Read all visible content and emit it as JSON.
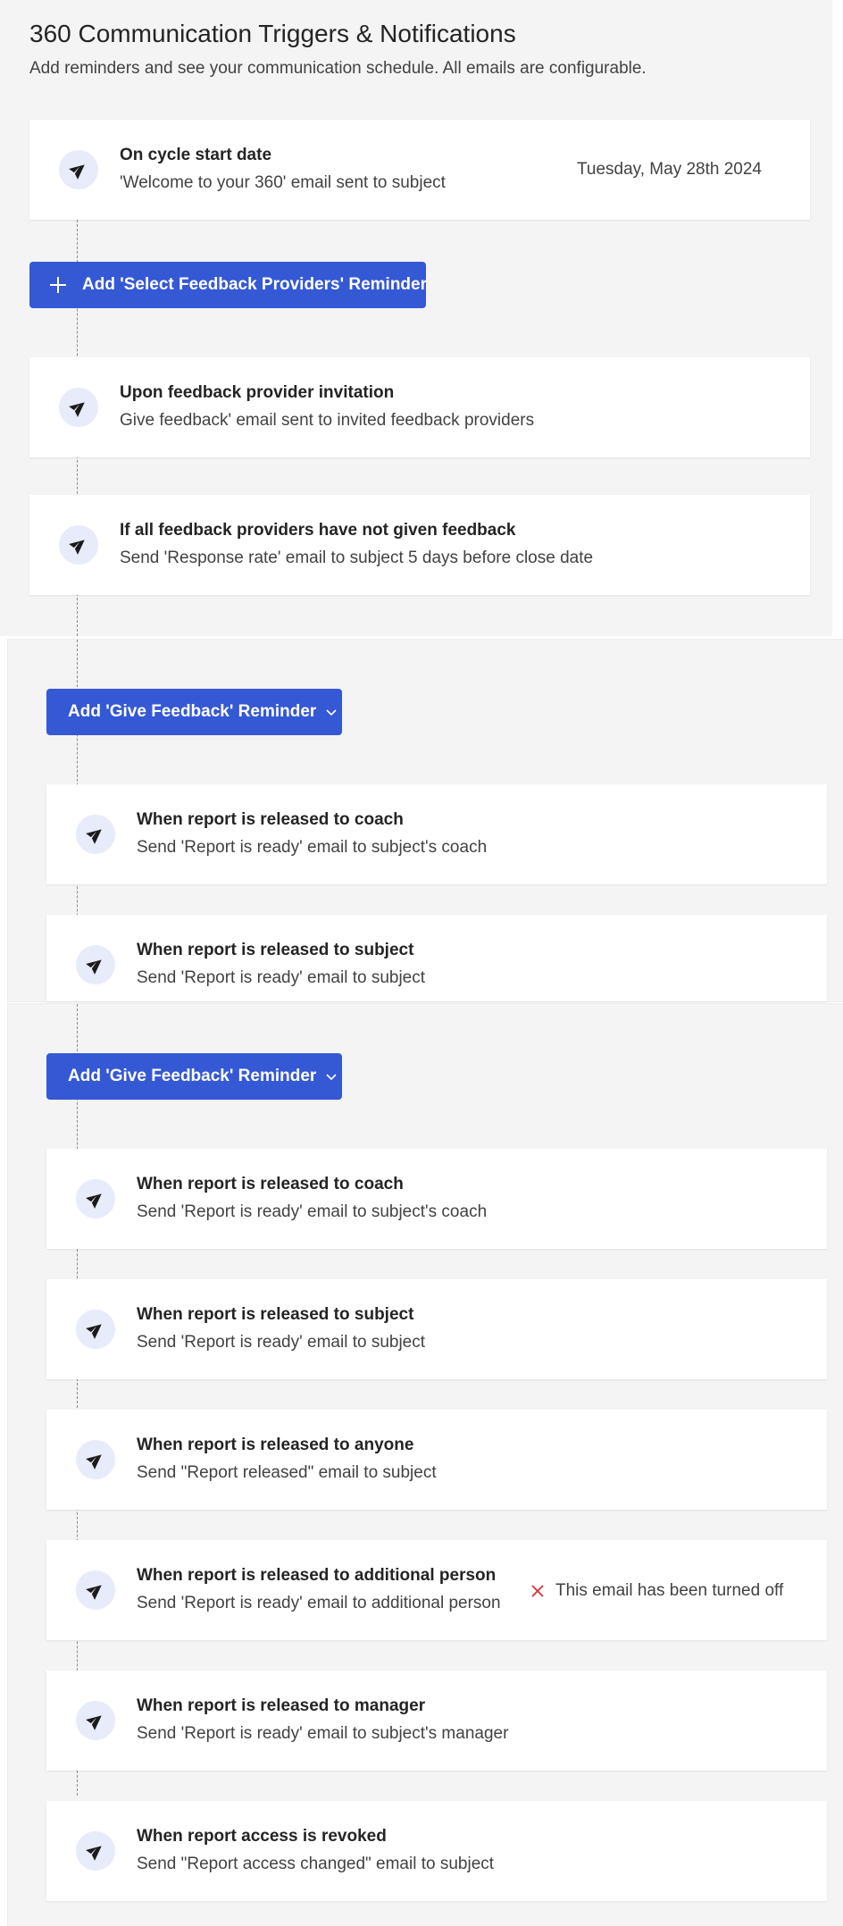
{
  "header": {
    "title": "360 Communication Triggers & Notifications",
    "subtitle": "Add reminders and see your communication schedule. All emails are configurable."
  },
  "colors": {
    "accent": "#3558d4",
    "icon_bg": "#e8ebfa",
    "off_icon": "#d13438",
    "panel_bg": "#f4f4f4"
  },
  "icons": {
    "trigger": "send-icon",
    "add": "plus-icon",
    "dropdown": "chevron-down-icon",
    "off": "close-icon"
  },
  "cards": [
    {
      "title": "On cycle start date",
      "desc": "'Welcome to your 360' email sent to subject",
      "date": "Tuesday, May 28th 2024"
    },
    {
      "title": "Upon feedback provider invitation",
      "desc": "Give feedback' email sent to invited feedback providers"
    },
    {
      "title": "If all feedback providers have not given feedback",
      "desc": "Send 'Response rate' email to subject 5 days before close date"
    },
    {
      "title": "When report is released to coach",
      "desc": "Send 'Report is ready' email to subject's coach"
    },
    {
      "title": "When report is released to subject",
      "desc": "Send 'Report is ready' email to subject"
    },
    {
      "title": "When report is released to coach",
      "desc": "Send 'Report is ready' email to subject's coach"
    },
    {
      "title": "When report is released to subject",
      "desc": "Send 'Report is ready' email to subject"
    },
    {
      "title": "When report is released to anyone",
      "desc": "Send \"Report released\" email to subject"
    },
    {
      "title": "When report is released to additional person",
      "desc": "Send 'Report is ready' email to additional person",
      "status": "This email has been turned off"
    },
    {
      "title": "When report is released to manager",
      "desc": "Send 'Report is ready' email to subject's manager"
    },
    {
      "title": "When report access is revoked",
      "desc": "Send \"Report access changed\" email to subject"
    }
  ],
  "buttons": {
    "select_providers": "Add 'Select Feedback Providers' Reminder",
    "give_feedback_1": "Add 'Give Feedback' Reminder",
    "give_feedback_2": "Add 'Give Feedback' Reminder"
  }
}
